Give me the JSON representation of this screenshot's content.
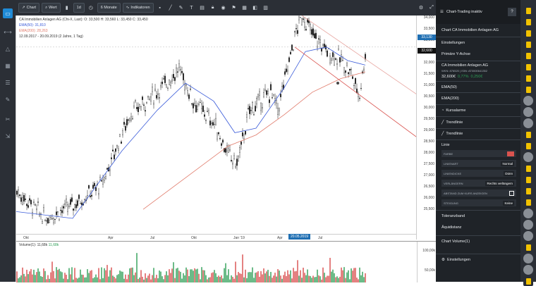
{
  "toolbar": {
    "chart": "Chart",
    "wert": "Wert",
    "interval": "1d",
    "range": "6 Monate",
    "indikatoren": "Indikatoren"
  },
  "legend": {
    "name": "CA Immobilien Anlagen AG (Chi-X, Last): O: 33,500 H: 33,560 L: 33,450 C: 33,450",
    "ema50": "EMA(50): 31,810",
    "ema200": "EMA(200): 28,263",
    "range": "12.09.2017 - 20.09.2019 (2 Jahre, 1 Tag)"
  },
  "price_axis": {
    "ticks": [
      "34,000",
      "33,500",
      "33,000",
      "32,500",
      "32,000",
      "31,500",
      "31,000",
      "30,500",
      "30,000",
      "29,500",
      "29,000",
      "28,500",
      "28,000",
      "27,500",
      "27,000",
      "26,500",
      "26,000",
      "25,500"
    ],
    "label1": "33,130",
    "label2": "32,600"
  },
  "time_axis": {
    "ticks": [
      "Okt",
      "Apr",
      "Jul",
      "Okt",
      "Jan '19",
      "Apr",
      "Jul"
    ],
    "highlight": "20.05.2019"
  },
  "volume": {
    "legend": "Volume(1): 11,68k",
    "legend_val": "11,68k",
    "ticks": [
      "100,00k",
      "50,00k"
    ]
  },
  "panel": {
    "header": "Chart-Trading inaktiv",
    "help": "?",
    "title": "Chart CA Immobilien Anlagen AG",
    "einstellungen": "Einstellungen",
    "primaere_achse": "Primäre Y-Achse",
    "stock_name": "CA Immobilien Anlagen AG",
    "stock_ids": "WKN: 876520 | ISIN: AT0000641352",
    "stock_price": "32,600€",
    "stock_change": "0,77%",
    "stock_change_abs": "0,250€",
    "ema50": "EMA(50)",
    "ema200": "EMA(200)",
    "kursalarme": "Kursalarme",
    "trendlinie1": "Trendlinie",
    "trendlinie2": "Trendlinie",
    "linie": "Linie",
    "farbe": "FARBE",
    "linienart": "LINIENART",
    "linienart_val": "Normal",
    "liniendicke": "LINIENDICKE",
    "liniendicke_val": "Dünn",
    "verlaengern": "VERLÄNGERN",
    "verlaengern_val": "Rechts verlängern",
    "abstand": "ABSTAND ZUM KURS ANZEIGEN",
    "steigung": "STEIGUNG",
    "steigung_val": "Keine",
    "toleranzband": "Toleranzband",
    "aequidistanz": "Äquidistanz",
    "chart_volume": "Chart Volume(1)",
    "vol_einstellungen": "Einstellungen"
  },
  "colors": {
    "accent": "#1f8ad6",
    "ema50": "#3a5bd9",
    "ema200": "#e07a6a",
    "trend": "#d9534f",
    "up": "#2e9e56",
    "down": "#d94b4b"
  }
}
